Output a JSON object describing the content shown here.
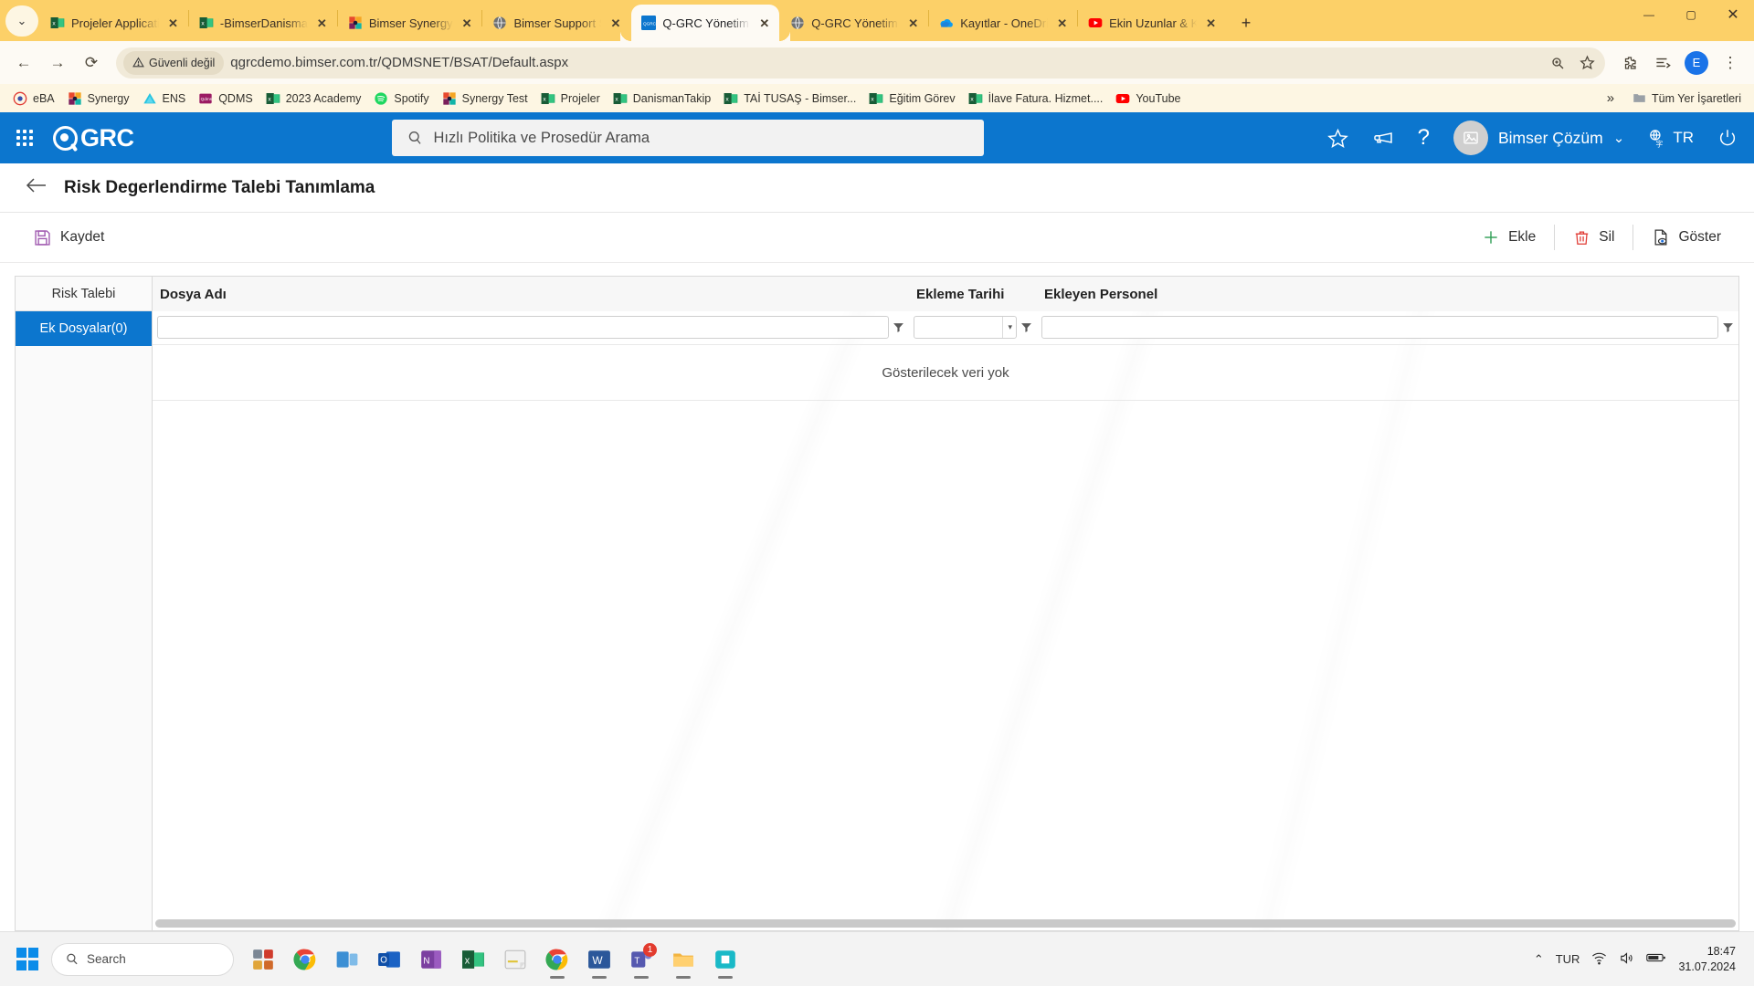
{
  "browser": {
    "tablist_icon": "chevron-down-icon",
    "tabs": [
      {
        "title": "Projeler Applicati",
        "favicon": "excel-icon",
        "active": false
      },
      {
        "title": "-BimserDanisman",
        "favicon": "excel-icon",
        "active": false
      },
      {
        "title": "Bimser Synergy",
        "favicon": "synergy-icon",
        "active": false
      },
      {
        "title": "Bimser Support S",
        "favicon": "globe-icon",
        "active": false
      },
      {
        "title": "Q-GRC Yönetim S",
        "favicon": "qgrc-icon",
        "active": true
      },
      {
        "title": "Q-GRC Yönetim S",
        "favicon": "globe-icon",
        "active": false
      },
      {
        "title": "Kayıtlar - OneDri",
        "favicon": "onedrive-icon",
        "active": false
      },
      {
        "title": "Ekin Uzunlar & K",
        "favicon": "youtube-icon",
        "active": false
      }
    ],
    "close_label": "✕",
    "new_tab_label": "+",
    "window_controls": {
      "minimize": "—",
      "maximize": "▢",
      "close": "✕"
    },
    "nav": {
      "back": "←",
      "forward": "→",
      "reload": "⟳",
      "security_label": "Güvenli değil",
      "security_icon": "warning-triangle-icon",
      "url": "qgrcdemo.bimser.com.tr/QDMSNET/BSAT/Default.aspx",
      "zoom_icon": "zoom-icon",
      "bookmark_icon": "star-icon",
      "extensions_icon": "puzzle-icon",
      "reading_list_icon": "reading-list-icon",
      "profile_initial": "E",
      "menu_icon": "kebab-menu-icon"
    },
    "bookmarks": [
      {
        "label": "eBA",
        "icon": "eba-icon"
      },
      {
        "label": "Synergy",
        "icon": "synergy-icon"
      },
      {
        "label": "ENS",
        "icon": "ens-icon"
      },
      {
        "label": "QDMS",
        "icon": "qdms-icon"
      },
      {
        "label": "2023 Academy",
        "icon": "excel-icon"
      },
      {
        "label": "Spotify",
        "icon": "spotify-icon"
      },
      {
        "label": "Synergy Test",
        "icon": "synergy-icon"
      },
      {
        "label": "Projeler",
        "icon": "excel-icon"
      },
      {
        "label": "DanismanTakip",
        "icon": "excel-icon"
      },
      {
        "label": "TAİ TUSAŞ - Bimser...",
        "icon": "excel-icon"
      },
      {
        "label": "Eğitim Görev",
        "icon": "excel-icon"
      },
      {
        "label": "İlave Fatura. Hizmet....",
        "icon": "excel-icon"
      },
      {
        "label": "YouTube",
        "icon": "youtube-icon"
      }
    ],
    "bookmarks_overflow": "»",
    "all_bookmarks_label": "Tüm Yer İşaretleri",
    "all_bookmarks_icon": "folder-icon"
  },
  "app": {
    "brand": "GRC",
    "apps_grid_icon": "apps-grid-icon",
    "search": {
      "placeholder": "Hızlı Politika ve Prosedür Arama",
      "icon": "search-icon",
      "value": ""
    },
    "header_icons": [
      {
        "name": "favorites-star-icon",
        "glyph": "☆"
      },
      {
        "name": "announcements-megaphone-icon",
        "glyph": "◁"
      },
      {
        "name": "help-question-icon",
        "glyph": "?"
      }
    ],
    "user": {
      "name": "Bimser Çözüm",
      "avatar_icon": "user-avatar-icon",
      "chevron": "⌄"
    },
    "language": {
      "label": "TR",
      "icon": "translate-icon"
    },
    "power_icon": "power-icon",
    "colors": {
      "header_blue": "#0c76ce",
      "accent_selected": "#0c76ce",
      "tab_strip_yellow": "#fcd068"
    }
  },
  "page": {
    "back_icon": "back-arrow-icon",
    "title": "Risk Degerlendirme Talebi Tanımlama",
    "toolbar_left": [
      {
        "label": "Kaydet",
        "icon": "save-floppy-icon"
      }
    ],
    "toolbar_right": [
      {
        "label": "Ekle",
        "icon": "plus-icon"
      },
      {
        "label": "Sil",
        "icon": "trash-icon"
      },
      {
        "label": "Göster",
        "icon": "preview-eye-icon"
      }
    ],
    "sidebar": [
      {
        "label": "Risk Talebi",
        "active": false
      },
      {
        "label": "Ek Dosyalar(0)",
        "active": true
      }
    ],
    "grid": {
      "columns": [
        "Dosya Adı",
        "Ekleme Tarihi",
        "Ekleyen Personel"
      ],
      "filters": [
        {
          "type": "text",
          "value": "",
          "filter_icon": "funnel-icon"
        },
        {
          "type": "select",
          "value": "",
          "filter_icon": "funnel-icon"
        },
        {
          "type": "text",
          "value": "",
          "filter_icon": "funnel-icon"
        }
      ],
      "rows": [],
      "empty_message": "Gösterilecek veri yok"
    }
  },
  "taskbar": {
    "start_icon": "windows-start-icon",
    "search_placeholder": "Search",
    "search_icon": "search-icon",
    "items": [
      {
        "name": "widgets-icon",
        "running": false
      },
      {
        "name": "chrome-icon",
        "running": false
      },
      {
        "name": "task-view-icon",
        "running": false
      },
      {
        "name": "outlook-icon",
        "running": false
      },
      {
        "name": "onenote-icon",
        "running": false
      },
      {
        "name": "excel-icon",
        "running": false
      },
      {
        "name": "sticky-notes-icon",
        "running": false
      },
      {
        "name": "chrome-active-icon",
        "running": true
      },
      {
        "name": "word-icon",
        "running": true
      },
      {
        "name": "teams-icon",
        "running": true,
        "badge": "1"
      },
      {
        "name": "file-explorer-icon",
        "running": true
      },
      {
        "name": "app-icon",
        "running": true
      }
    ],
    "tray": {
      "chevron": "⌃",
      "language": "TUR",
      "wifi_icon": "wifi-icon",
      "volume_icon": "volume-icon",
      "battery_icon": "battery-icon",
      "time": "18:47",
      "date": "31.07.2024"
    }
  }
}
